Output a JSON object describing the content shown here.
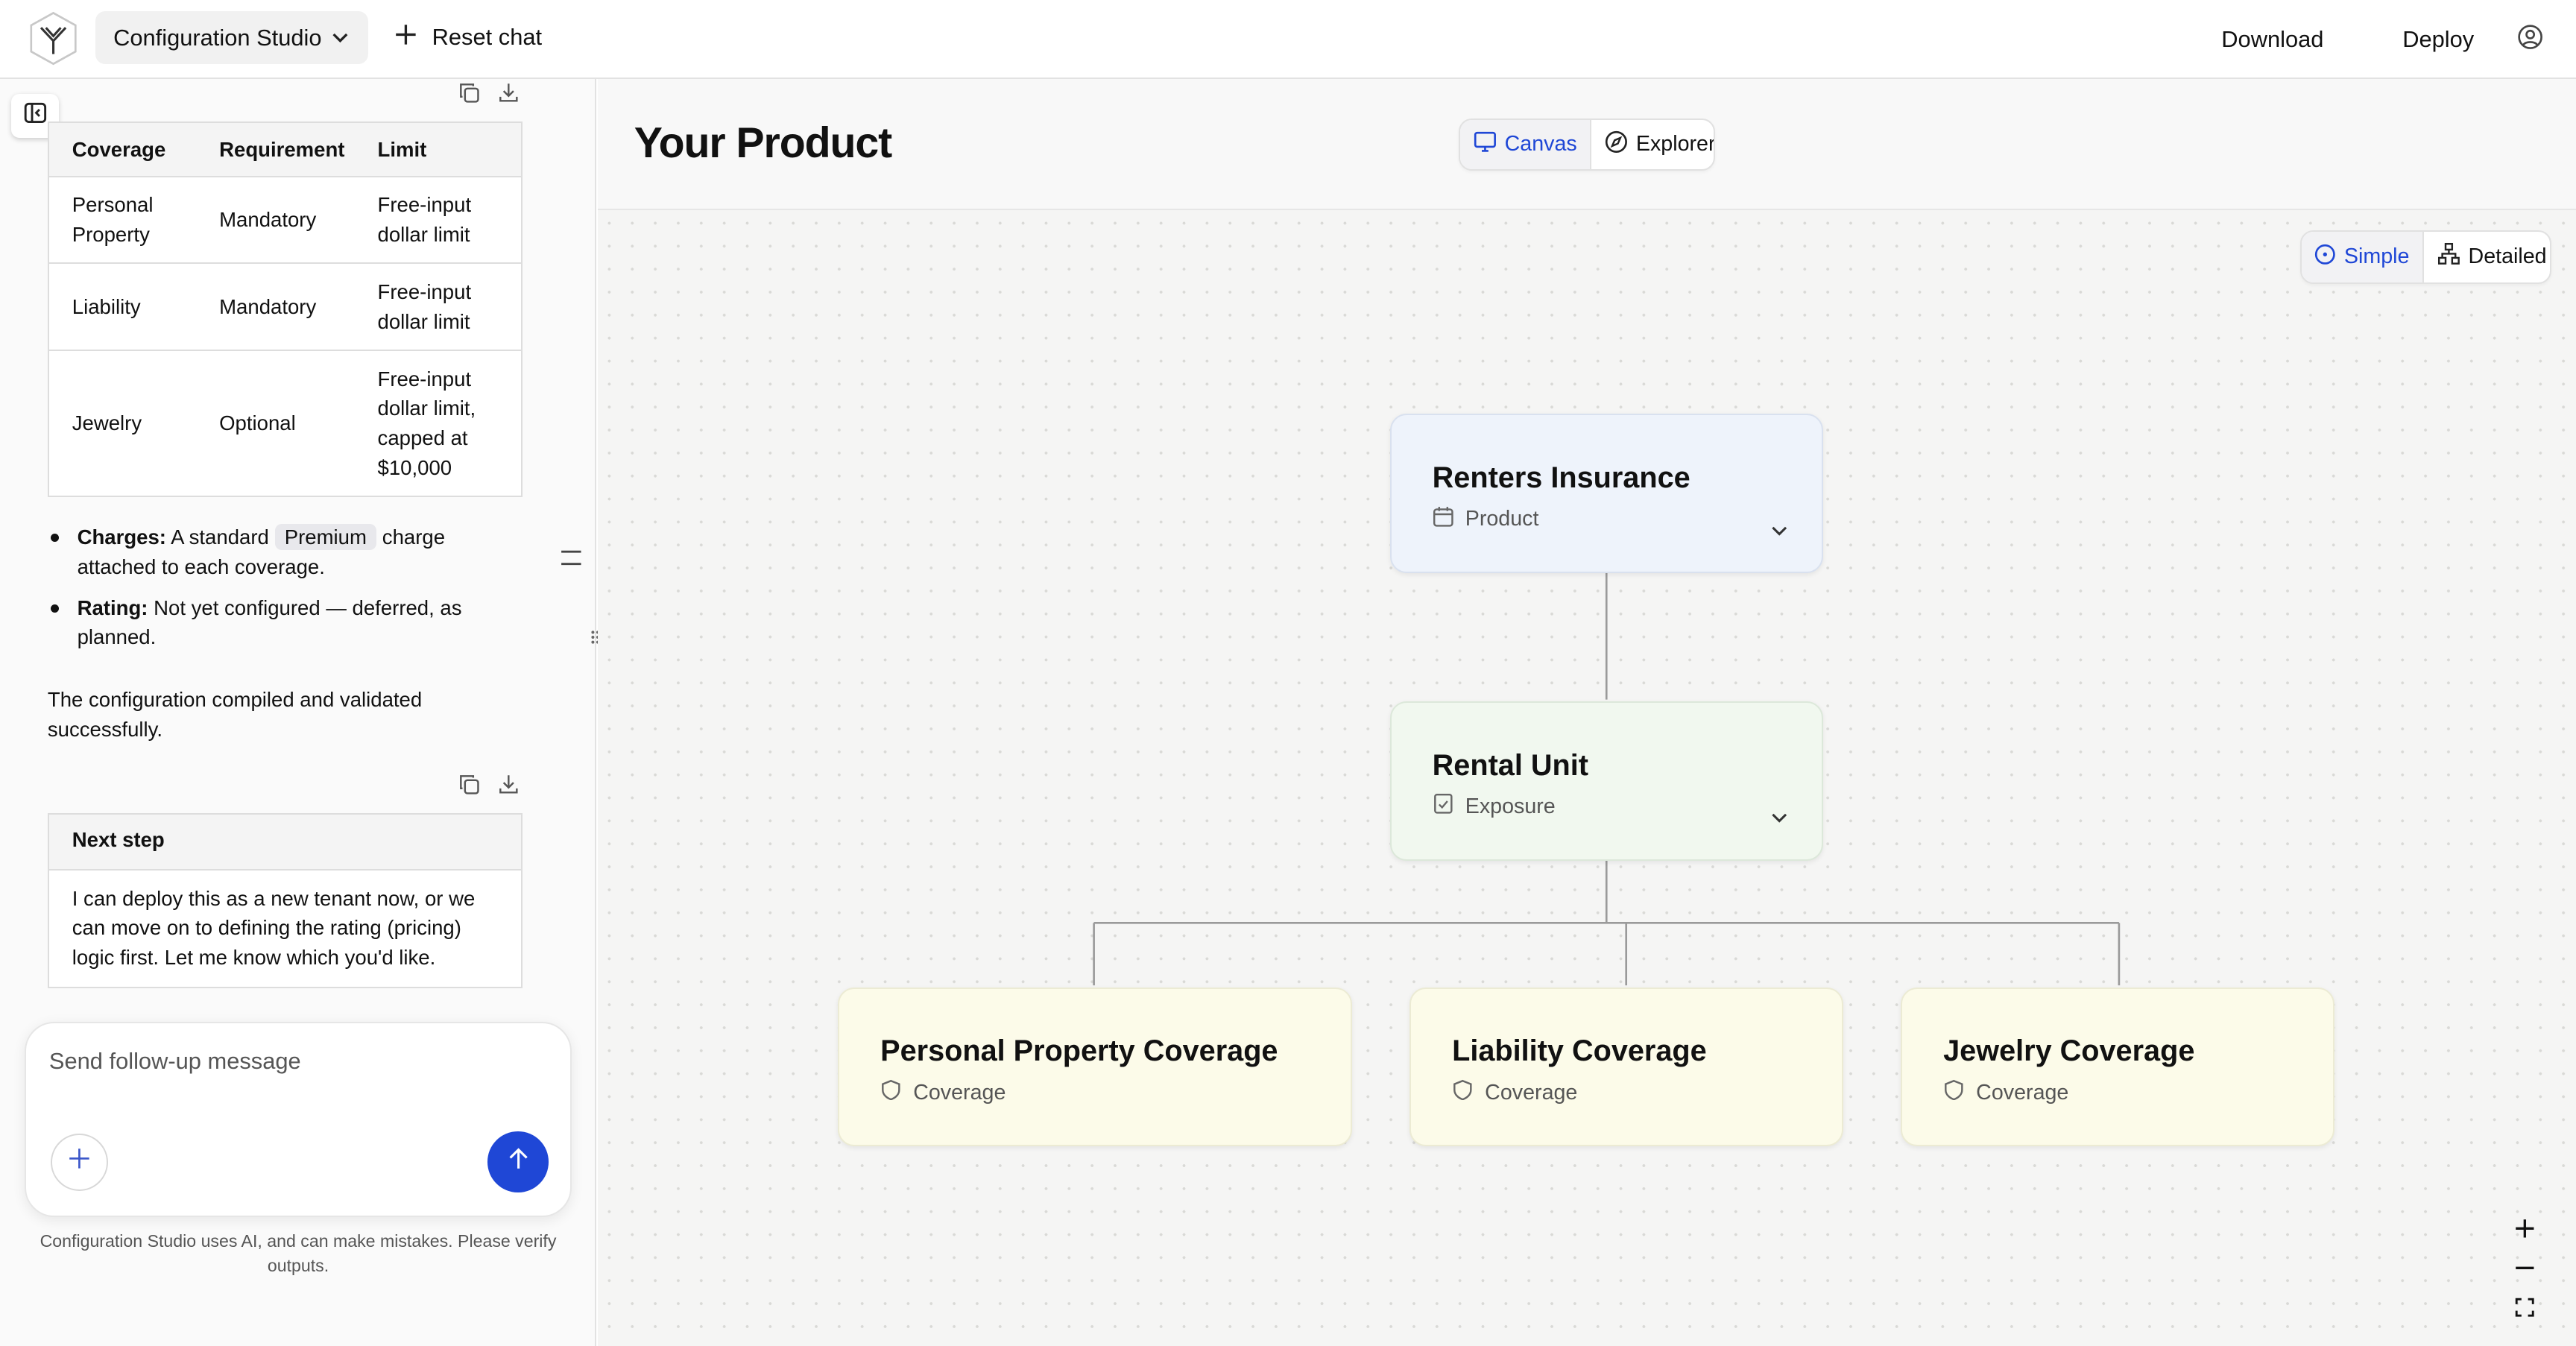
{
  "topbar": {
    "app_name": "Configuration Studio",
    "reset_label": "Reset chat",
    "download_label": "Download",
    "deploy_label": "Deploy"
  },
  "chat": {
    "table": {
      "headers": [
        "Coverage",
        "Requirement",
        "Limit"
      ],
      "rows": [
        [
          "Personal Property",
          "Mandatory",
          "Free-input dollar limit"
        ],
        [
          "Liability",
          "Mandatory",
          "Free-input dollar limit"
        ],
        [
          "Jewelry",
          "Optional",
          "Free-input dollar limit, capped at $10,000"
        ]
      ]
    },
    "bullets": {
      "charges_label": "Charges:",
      "charges_pre": "A standard",
      "charges_pill": "Premium",
      "charges_post": "charge attached to each coverage.",
      "rating_label": "Rating:",
      "rating_text": "Not yet configured — deferred, as planned."
    },
    "summary": "The configuration compiled and validated successfully.",
    "next_step": {
      "header": "Next step",
      "body": "I can deploy this as a new tenant now, or we can move on to defining the rating (pricing) logic first. Let me know which you'd like."
    },
    "composer_placeholder": "Send follow-up message",
    "disclaimer": "Configuration Studio uses AI, and can make mistakes. Please verify outputs."
  },
  "main": {
    "title": "Your Product",
    "view_tabs": [
      "Canvas",
      "Explorer"
    ],
    "detail_tabs": [
      "Simple",
      "Detailed"
    ]
  },
  "nodes": {
    "root": {
      "title": "Renters Insurance",
      "type": "Product",
      "color": "#eef3fb"
    },
    "exposure": {
      "title": "Rental Unit",
      "type": "Exposure",
      "color": "#f1f8ef"
    },
    "cov1": {
      "title": "Personal Property Coverage",
      "type": "Coverage",
      "color": "#fcfbe9"
    },
    "cov2": {
      "title": "Liability Coverage",
      "type": "Coverage",
      "color": "#fcfbe9"
    },
    "cov3": {
      "title": "Jewelry Coverage",
      "type": "Coverage",
      "color": "#fcfbe9"
    }
  },
  "colors": {
    "accent": "#1f47d6"
  }
}
